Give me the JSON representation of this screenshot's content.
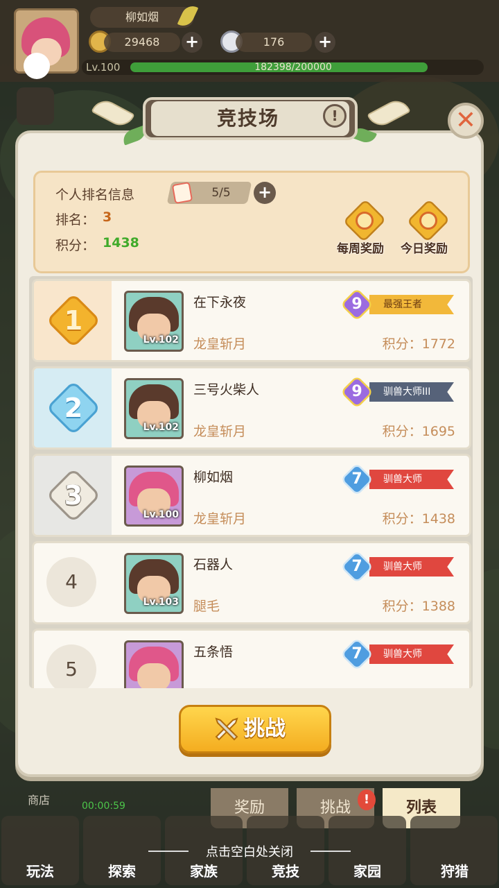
{
  "player": {
    "name": "柳如烟",
    "gold": "29468",
    "gems": "176",
    "level": "Lv.100",
    "exp": "182398/200000",
    "exp_progress": 0.912
  },
  "panel": {
    "title": "竞技场",
    "info_label": "!",
    "close_label": "✕"
  },
  "personal": {
    "header": "个人排名信息",
    "tickets": "5/5",
    "rank_label": "排名：",
    "rank_value": "3",
    "score_label": "积分：",
    "score_value": "1438",
    "weekly_reward": "每周奖励",
    "daily_reward": "今日奖励"
  },
  "rows": [
    {
      "rank": "1",
      "name": "在下永夜",
      "level": "Lv.102",
      "guild": "龙皇斩月",
      "score": "积分：1772",
      "tier": "9",
      "tier_name": "最强王者"
    },
    {
      "rank": "2",
      "name": "三号火柴人",
      "level": "Lv.102",
      "guild": "龙皇斩月",
      "score": "积分：1695",
      "tier": "9",
      "tier_name": "驯兽大师III"
    },
    {
      "rank": "3",
      "name": "柳如烟",
      "level": "Lv.100",
      "guild": "龙皇斩月",
      "score": "积分：1438",
      "tier": "7",
      "tier_name": "驯兽大师"
    },
    {
      "rank": "4",
      "name": "石器人",
      "level": "Lv.103",
      "guild": "腿毛",
      "score": "积分：1388",
      "tier": "7",
      "tier_name": "驯兽大师"
    },
    {
      "rank": "5",
      "name": "五条悟",
      "level": "",
      "guild": "",
      "score": "",
      "tier": "7",
      "tier_name": "驯兽大师"
    }
  ],
  "challenge_label": "挑战",
  "tabs": {
    "reward": "奖励",
    "challenge": "挑战",
    "list": "列表",
    "badge": "!"
  },
  "background": {
    "shop": "商店",
    "timer": "00:00:59"
  },
  "nav": [
    "玩法",
    "探索",
    "家族",
    "竞技",
    "家园",
    "狩猎"
  ],
  "close_hint": "点击空白处关闭"
}
